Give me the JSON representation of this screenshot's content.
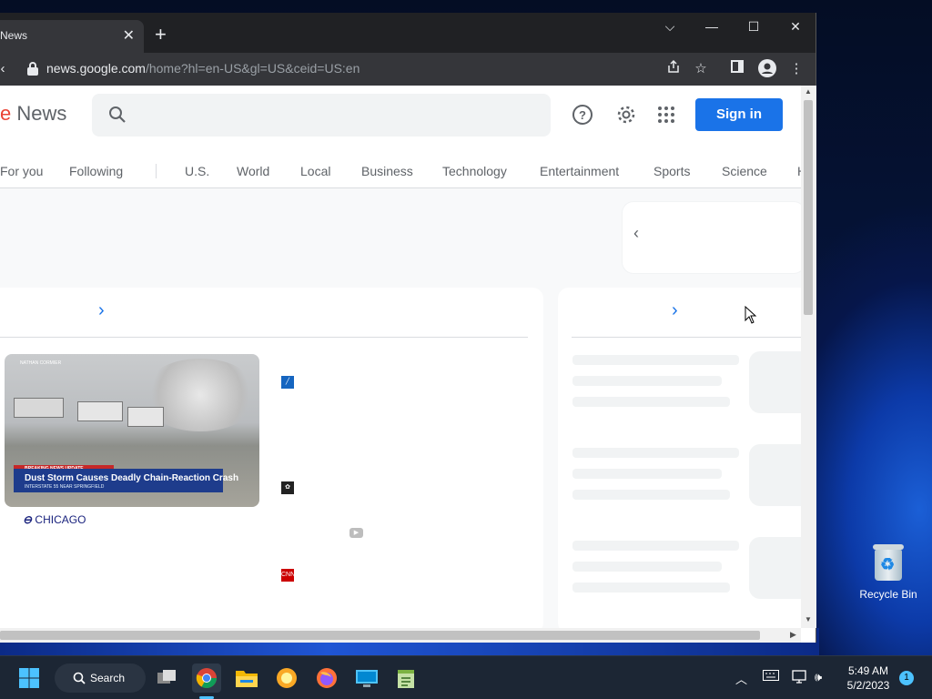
{
  "browser": {
    "tab_title": "News",
    "tab_close": "✕",
    "new_tab": "+",
    "url_host": "news.google.com",
    "url_path": "/home?hl=en-US&gl=US&ceid=US:en",
    "window_controls": {
      "menu": "⌵",
      "minimize": "—",
      "maximize": "☐",
      "close": "✕"
    }
  },
  "header": {
    "logo_prefix": "e",
    "logo_text": " News",
    "signin_label": "Sign in"
  },
  "nav": {
    "items": [
      "For you",
      "Following",
      "U.S.",
      "World",
      "Local",
      "Business",
      "Technology",
      "Entertainment",
      "Sports",
      "Science",
      "H"
    ]
  },
  "story": {
    "credit": "NATHAN CORMIER",
    "breaking": "BREAKING NEWS UPDATE",
    "headline": "Dust Storm Causes Deadly Chain-Reaction Crash",
    "subline": "INTERSTATE 55 NEAR SPRINGFIELD",
    "source_logo_text": "CHICAGO",
    "source_badge": "CNN"
  },
  "desktop": {
    "recycle_bin_label": "Recycle Bin"
  },
  "taskbar": {
    "search_label": "Search",
    "time": "5:49 AM",
    "date": "5/2/2023",
    "notification_count": "1"
  },
  "colors": {
    "accent": "#1a73e8",
    "chrome_dark": "#202124",
    "chrome_toolbar": "#35363a",
    "taskbar": "#1c2634"
  }
}
